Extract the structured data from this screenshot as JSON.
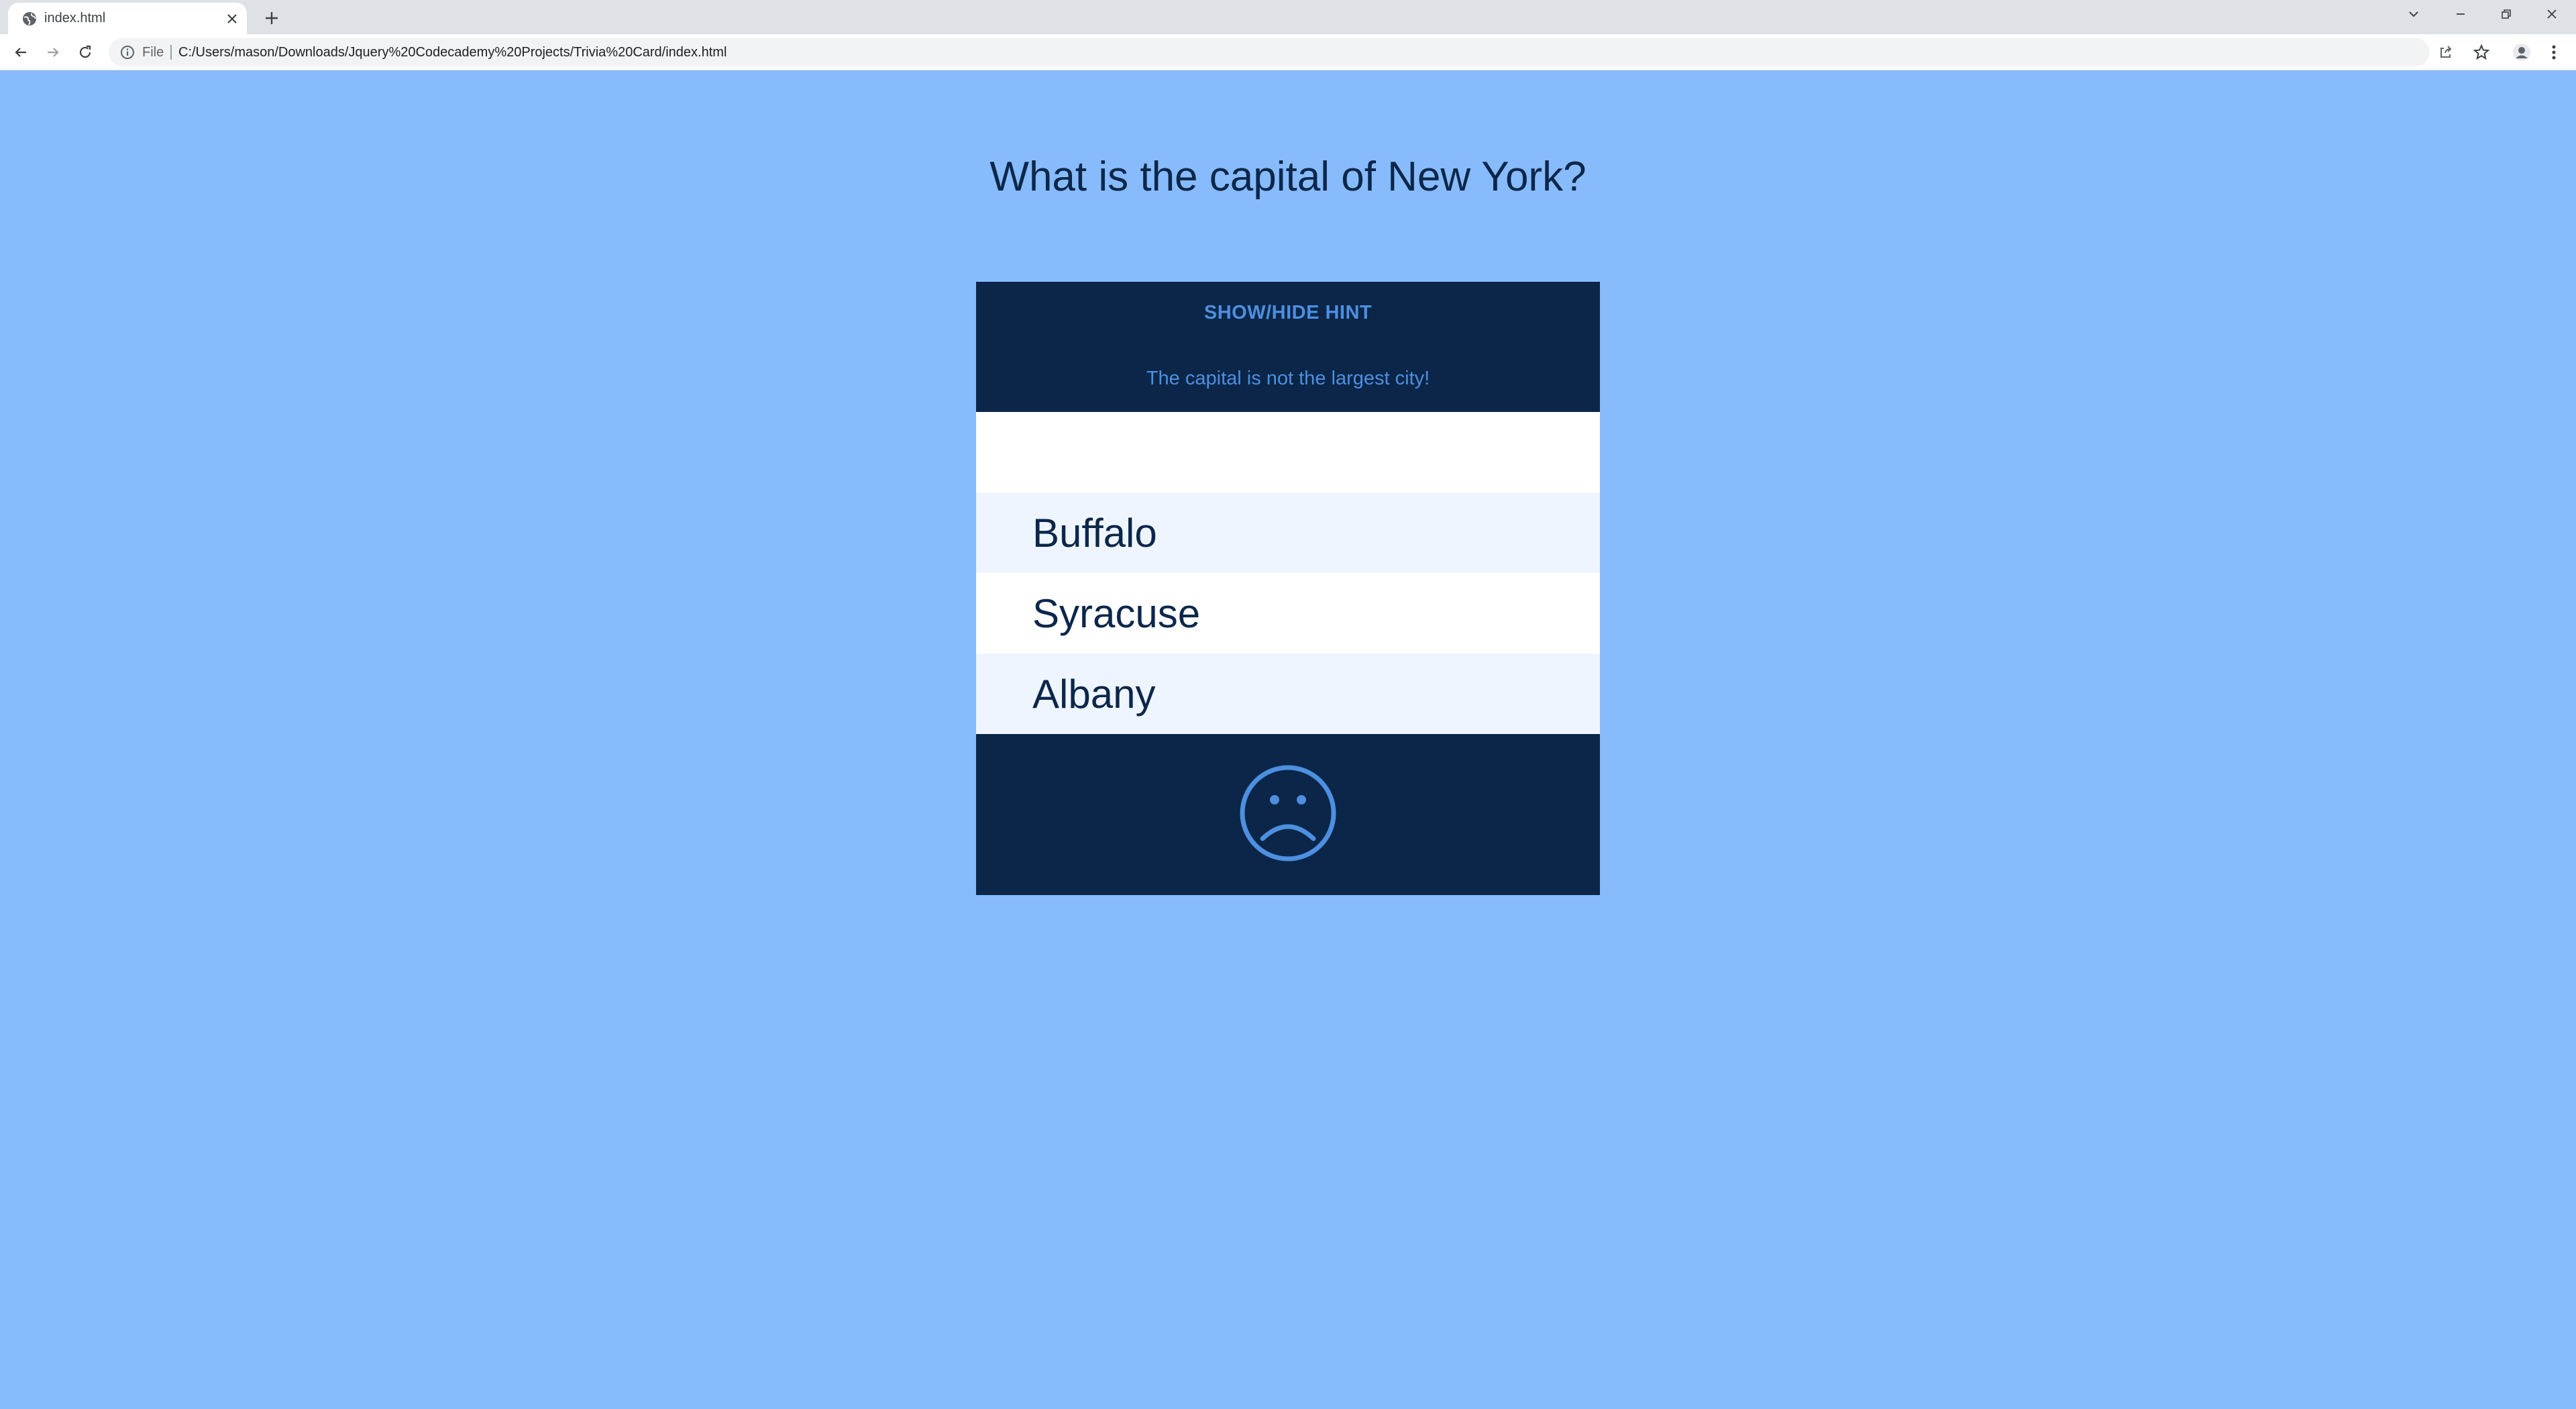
{
  "browser": {
    "tab_title": "index.html",
    "file_label": "File",
    "url": "C:/Users/mason/Downloads/Jquery%20Codecademy%20Projects/Trivia%20Card/index.html"
  },
  "page": {
    "question": "What is the capital of New York?",
    "hint_toggle_label": "SHOW/HIDE HINT",
    "hint_text": "The capital is not the largest city!",
    "answers": [
      "Buffalo",
      "Syracuse",
      "Albany"
    ],
    "result_icon": "sad-face-icon"
  },
  "colors": {
    "page_background": "#87bbfc",
    "panel_dark": "#0b2648",
    "accent_blue": "#4d8fe0",
    "text_dark": "#0c274a"
  }
}
